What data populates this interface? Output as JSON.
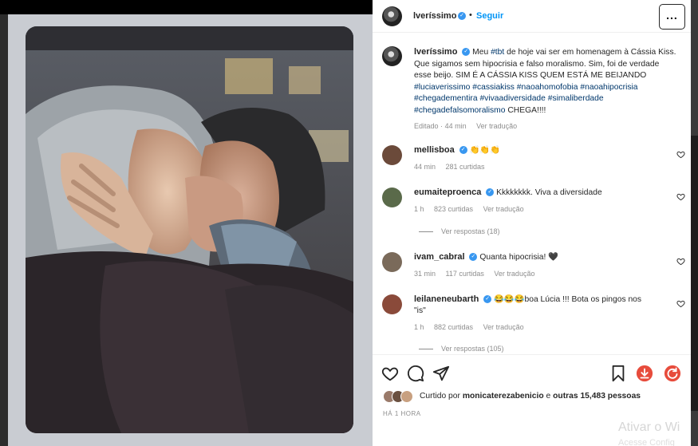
{
  "post": {
    "author": "lveríssimo",
    "follow_label": "Seguir",
    "more_label": "...",
    "separator": "•"
  },
  "caption": {
    "username": "lveríssimo",
    "parts": [
      {
        "text": "Meu ",
        "tag": false
      },
      {
        "text": "#tbt",
        "tag": true
      },
      {
        "text": " de hoje vai ser em homenagem à Cássia Kiss. Que sigamos sem hipocrisia e falso moralismo. Sim, foi de verdade esse beijo. SIM É A CÁSSIA KISS QUEM ESTÁ ME BEIJANDO ",
        "tag": false
      },
      {
        "text": "#luciaverissimo",
        "tag": true
      },
      {
        "text": " ",
        "tag": false
      },
      {
        "text": "#cassiakiss",
        "tag": true
      },
      {
        "text": " ",
        "tag": false
      },
      {
        "text": "#naoahomofobia",
        "tag": true
      },
      {
        "text": " ",
        "tag": false
      },
      {
        "text": "#naoahipocrisia",
        "tag": true
      },
      {
        "text": " ",
        "tag": false
      },
      {
        "text": "#chegadementira",
        "tag": true
      },
      {
        "text": " ",
        "tag": false
      },
      {
        "text": "#vivaadiversidade",
        "tag": true
      },
      {
        "text": " ",
        "tag": false
      },
      {
        "text": "#simaliberdade",
        "tag": true
      },
      {
        "text": " ",
        "tag": false
      },
      {
        "text": "#chegadefalsomoralismo",
        "tag": true
      },
      {
        "text": " CHEGA!!!!",
        "tag": false
      }
    ],
    "edited": "Editado",
    "separator": "·",
    "time": "44 min",
    "translate": "Ver tradução"
  },
  "comments": [
    {
      "username": "mellisboa",
      "text": "👏👏👏",
      "time": "44 min",
      "likes": "281 curtidas",
      "translate": "",
      "avatar_color": "#6b4a3a",
      "replies": ""
    },
    {
      "username": "eumaiteproenca",
      "text": "Kkkkkkkk. Viva a diversidade",
      "time": "1 h",
      "likes": "823 curtidas",
      "translate": "Ver tradução",
      "avatar_color": "#5a6a4a",
      "replies": "Ver respostas (18)"
    },
    {
      "username": "ivam_cabral",
      "text": "Quanta hipocrisia! 🖤",
      "time": "31 min",
      "likes": "117 curtidas",
      "translate": "Ver tradução",
      "avatar_color": "#7a6a5a",
      "replies": ""
    },
    {
      "username": "leilaneneubarth",
      "text": "😂😂😂boa Lúcia !!! Bota os pingos nos \"is\"",
      "time": "1 h",
      "likes": "882 curtidas",
      "translate": "Ver tradução",
      "avatar_color": "#8a4a3a",
      "replies": "Ver respostas (105)"
    }
  ],
  "footer": {
    "liked_prefix": "Curtido por ",
    "liked_user": "monicaterezabenicio",
    "liked_mid": " e ",
    "liked_count": "outras 15,483 pessoas",
    "time_ago": "HÁ 1 HORA"
  },
  "os_watermark": {
    "line1": "Ativar o Wi",
    "line2": "Acesse Config"
  },
  "colors": {
    "link_blue": "#0095f6",
    "hashtag": "#00376b",
    "verified": "#3897f0",
    "download_red": "#e74c3c",
    "muted": "#8e8e8e"
  }
}
